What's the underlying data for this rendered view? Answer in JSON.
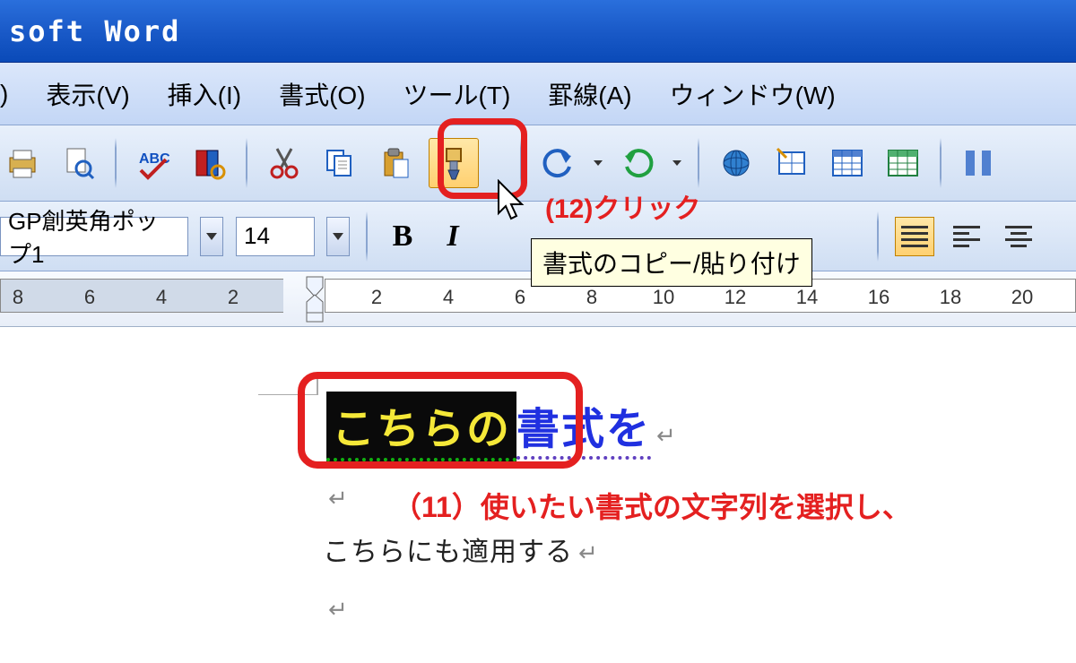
{
  "titlebar": {
    "text": "soft Word"
  },
  "menubar": {
    "items": [
      {
        "label": ")"
      },
      {
        "label": "表示(V)"
      },
      {
        "label": "挿入(I)"
      },
      {
        "label": "書式(O)"
      },
      {
        "label": "ツール(T)"
      },
      {
        "label": "罫線(A)"
      },
      {
        "label": "ウィンドウ(W)"
      }
    ]
  },
  "toolbar1": {
    "tooltip": "書式のコピー/貼り付け"
  },
  "toolbar2": {
    "font_name": "GP創英角ポップ1",
    "font_size": "14",
    "bold": "B",
    "italic": "I"
  },
  "ruler": {
    "left_nums": [
      "8",
      "6",
      "4",
      "2"
    ],
    "right_nums": [
      "2",
      "4",
      "6",
      "8",
      "10",
      "12",
      "14",
      "16",
      "18",
      "20"
    ]
  },
  "document": {
    "line1_selected": "こちらの",
    "line1_rest": "書式を",
    "line3": "こちらにも適用する",
    "para_mark": "↵"
  },
  "annotations": {
    "a12": "(12)クリック",
    "a11": "（11）使いたい書式の文字列を選択し、"
  }
}
